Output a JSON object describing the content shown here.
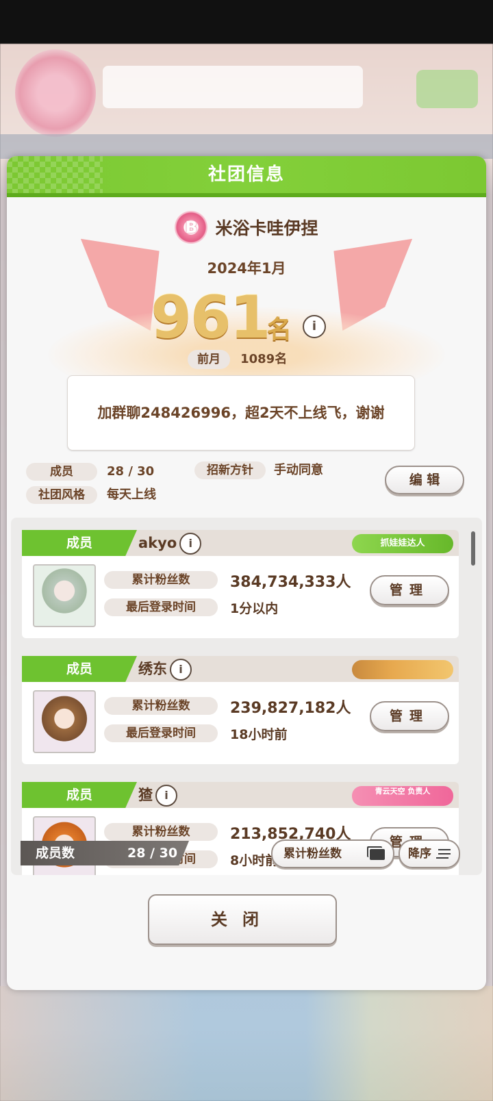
{
  "dialog": {
    "title": "社团信息",
    "club_badge": "B",
    "club_name": "米浴卡哇伊捏",
    "rank_month": "2024年1月",
    "rank_number": "961",
    "rank_unit": "名",
    "prev_label": "前月",
    "prev_value": "1089名",
    "notice": "加群聊248426996，超2天不上线飞，谢谢",
    "members_label": "成员",
    "members_value": "28 / 30",
    "policy_label": "招新方针",
    "policy_value": "手动同意",
    "style_label": "社团风格",
    "style_value": "每天上线",
    "edit_label": "编 辑",
    "close_label": "关闭",
    "info_glyph": "i"
  },
  "members": [
    {
      "role": "成员",
      "name": "akyo",
      "title_badge": "抓娃娃达人",
      "fans_label": "累计粉丝数",
      "fans": "384,734,333人",
      "login_label": "最后登录时间",
      "login": "1分以内",
      "manage_label": "管理"
    },
    {
      "role": "成员",
      "name": "绣东",
      "title_badge": "",
      "fans_label": "累计粉丝数",
      "fans": "239,827,182人",
      "login_label": "最后登录时间",
      "login": "18小时前",
      "manage_label": "管理"
    },
    {
      "role": "成员",
      "name": "猹",
      "title_badge": "青云天空 负责人",
      "fans_label": "累计粉丝数",
      "fans": "213,852,740人",
      "login_label": "最后登录时间",
      "login": "8小时前",
      "manage_label": "管理"
    }
  ],
  "footer": {
    "count_label": "成员数",
    "count_value": "28 / 30",
    "sort_field": "累计粉丝数",
    "sort_order": "降序"
  },
  "colors": {
    "accent_green": "#7cc832",
    "text_brown": "#6b4428",
    "gold": "#e7c06a"
  }
}
